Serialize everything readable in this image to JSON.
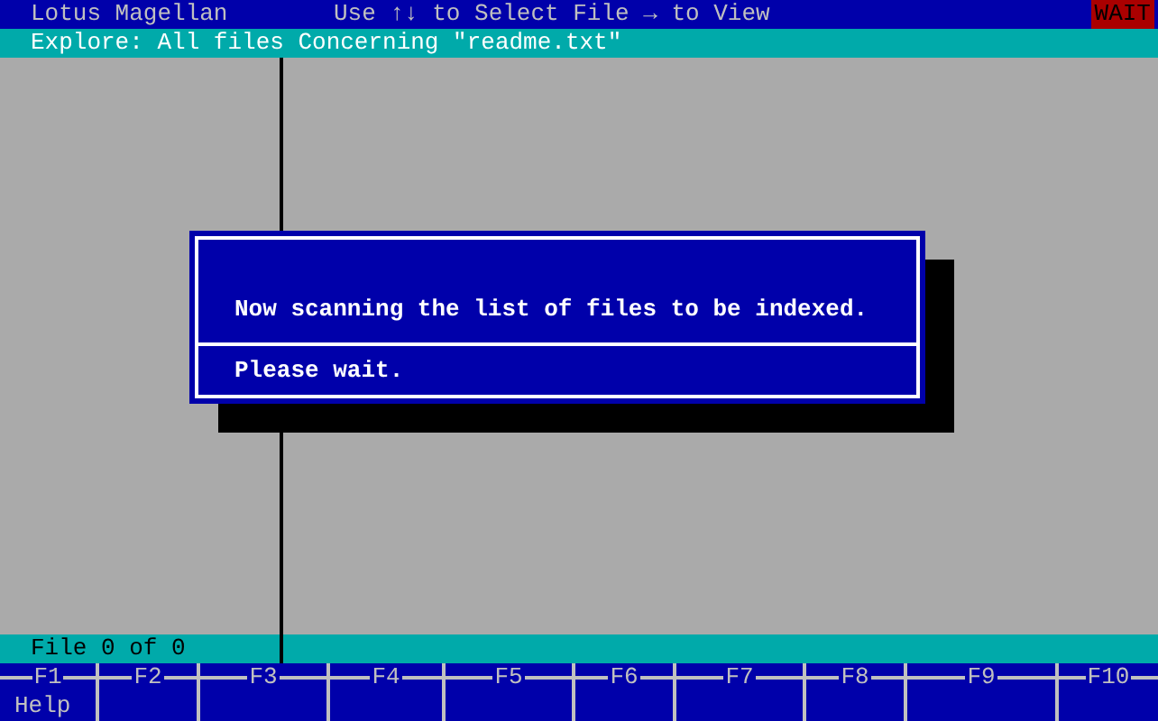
{
  "title_bar": {
    "app": "Lotus Magellan",
    "hint": "Use ↑↓ to Select File → to View",
    "status": "WAIT"
  },
  "explore_bar": {
    "text": "Explore: All files Concerning \"readme.txt\""
  },
  "dialog": {
    "message": "Now scanning the list of files to be indexed.",
    "footer": "Please wait."
  },
  "status_bar": {
    "text": "File 0 of 0"
  },
  "function_keys": [
    {
      "key": "F1",
      "label": "Help"
    },
    {
      "key": "F2"
    },
    {
      "key": "F3"
    },
    {
      "key": "F4"
    },
    {
      "key": "F5"
    },
    {
      "key": "F6"
    },
    {
      "key": "F7"
    },
    {
      "key": "F8"
    },
    {
      "key": "F9"
    },
    {
      "key": "F10"
    }
  ]
}
